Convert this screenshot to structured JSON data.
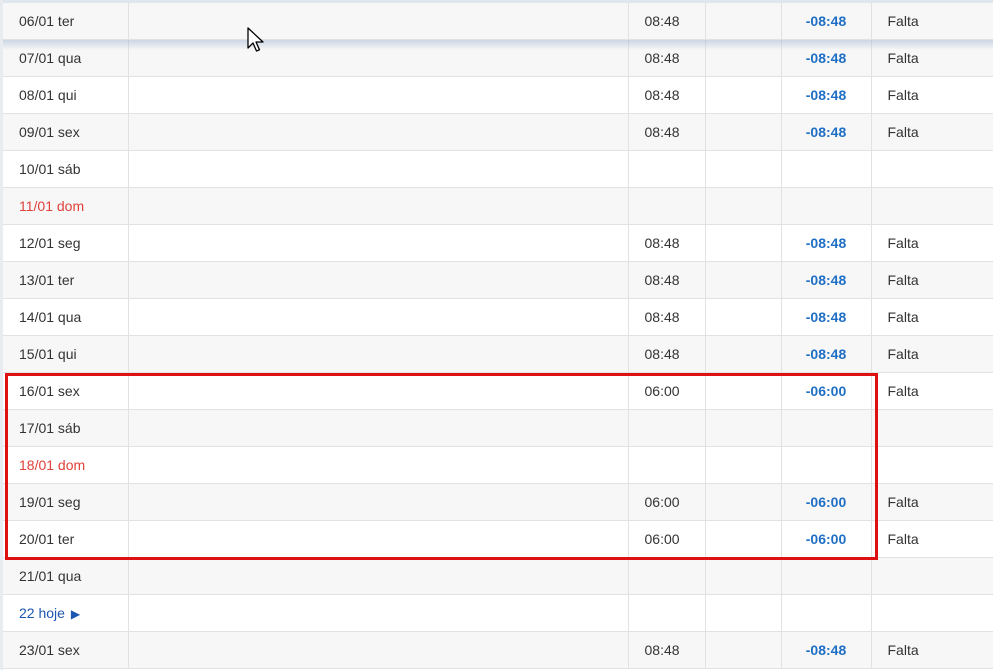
{
  "rows": [
    {
      "date": "06/01 ter",
      "hours": "08:48",
      "balance": "-08:48",
      "status": "Falta",
      "style": "alt"
    },
    {
      "date": "07/01 qua",
      "hours": "08:48",
      "balance": "-08:48",
      "status": "Falta",
      "style": "alt"
    },
    {
      "date": "08/01 qui",
      "hours": "08:48",
      "balance": "-08:48",
      "status": "Falta",
      "style": "plain"
    },
    {
      "date": "09/01 sex",
      "hours": "08:48",
      "balance": "-08:48",
      "status": "Falta",
      "style": "alt"
    },
    {
      "date": "10/01 sáb",
      "hours": "",
      "balance": "",
      "status": "",
      "style": "plain"
    },
    {
      "date": "11/01 dom",
      "hours": "",
      "balance": "",
      "status": "",
      "style": "alt",
      "date_color": "red"
    },
    {
      "date": "12/01 seg",
      "hours": "08:48",
      "balance": "-08:48",
      "status": "Falta",
      "style": "plain"
    },
    {
      "date": "13/01 ter",
      "hours": "08:48",
      "balance": "-08:48",
      "status": "Falta",
      "style": "alt"
    },
    {
      "date": "14/01 qua",
      "hours": "08:48",
      "balance": "-08:48",
      "status": "Falta",
      "style": "plain"
    },
    {
      "date": "15/01 qui",
      "hours": "08:48",
      "balance": "-08:48",
      "status": "Falta",
      "style": "alt"
    },
    {
      "date": "16/01 sex",
      "hours": "06:00",
      "balance": "-06:00",
      "status": "Falta",
      "style": "plain"
    },
    {
      "date": "17/01 sáb",
      "hours": "",
      "balance": "",
      "status": "",
      "style": "alt"
    },
    {
      "date": "18/01 dom",
      "hours": "",
      "balance": "",
      "status": "",
      "style": "plain",
      "date_color": "red"
    },
    {
      "date": "19/01 seg",
      "hours": "06:00",
      "balance": "-06:00",
      "status": "Falta",
      "style": "alt"
    },
    {
      "date": "20/01 ter",
      "hours": "06:00",
      "balance": "-06:00",
      "status": "Falta",
      "style": "plain"
    },
    {
      "date": "21/01 qua",
      "hours": "",
      "balance": "",
      "status": "",
      "style": "alt"
    },
    {
      "date": "22 hoje",
      "hours": "",
      "balance": "",
      "status": "",
      "style": "plain",
      "date_color": "today",
      "today_arrow": "▶"
    },
    {
      "date": "23/01 sex",
      "hours": "08:48",
      "balance": "-08:48",
      "status": "Falta",
      "style": "alt"
    }
  ],
  "colors": {
    "weekend_red": "#e0413a",
    "today_blue": "#1b56b0",
    "balance_blue": "#1f6fc5",
    "highlight_red": "#dd1111"
  },
  "icons": {
    "today_arrow": "play-arrow-icon",
    "cursor": "mouse-pointer-icon"
  }
}
